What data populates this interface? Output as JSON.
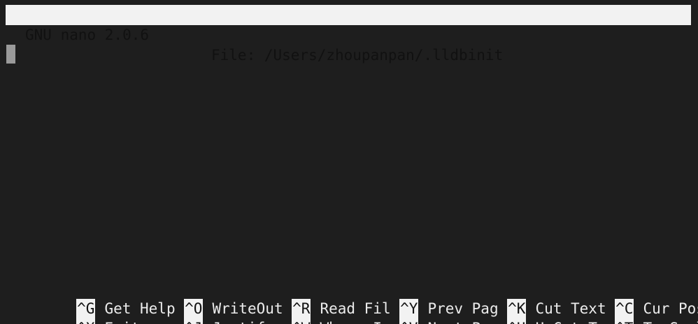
{
  "titlebar": {
    "app": "GNU nano 2.0.6",
    "file": "File: /Users/zhoupanpan/.lldbinit"
  },
  "editor": {
    "content": ""
  },
  "shortcuts": {
    "row1": [
      {
        "key": "^G",
        "label": "Get Help"
      },
      {
        "key": "^O",
        "label": "WriteOut"
      },
      {
        "key": "^R",
        "label": "Read Fil"
      },
      {
        "key": "^Y",
        "label": "Prev Pag"
      },
      {
        "key": "^K",
        "label": "Cut Text"
      },
      {
        "key": "^C",
        "label": "Cur Pos"
      }
    ],
    "row2": [
      {
        "key": "^X",
        "label": "Exit"
      },
      {
        "key": "^J",
        "label": "Justify"
      },
      {
        "key": "^W",
        "label": "Where Is"
      },
      {
        "key": "^V",
        "label": "Next Pag"
      },
      {
        "key": "^U",
        "label": "UnCut Te"
      },
      {
        "key": "^T",
        "label": "To Spell"
      }
    ]
  },
  "colors": {
    "background": "#1e1e1e",
    "inverse_bg": "#f2f2f2",
    "text": "#ececec",
    "cursor": "#9a9a9a"
  }
}
